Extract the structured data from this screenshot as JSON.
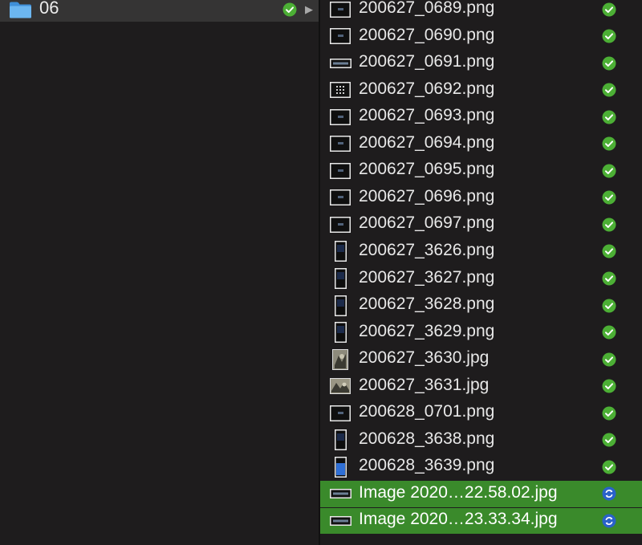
{
  "left": {
    "folder": {
      "name": "06",
      "icon": "folder-icon",
      "status": "synced",
      "disclosure": "▶"
    }
  },
  "files": [
    {
      "name": "200627_0689.png",
      "thumb": "landscape",
      "status": "synced"
    },
    {
      "name": "200627_0690.png",
      "thumb": "landscape",
      "status": "synced"
    },
    {
      "name": "200627_0691.png",
      "thumb": "wide",
      "status": "synced"
    },
    {
      "name": "200627_0692.png",
      "thumb": "square",
      "status": "synced"
    },
    {
      "name": "200627_0693.png",
      "thumb": "landscape",
      "status": "synced"
    },
    {
      "name": "200627_0694.png",
      "thumb": "landscape",
      "status": "synced"
    },
    {
      "name": "200627_0695.png",
      "thumb": "landscape",
      "status": "synced"
    },
    {
      "name": "200627_0696.png",
      "thumb": "landscape",
      "status": "synced"
    },
    {
      "name": "200627_0697.png",
      "thumb": "landscape",
      "status": "synced"
    },
    {
      "name": "200627_3626.png",
      "thumb": "portrait",
      "status": "synced"
    },
    {
      "name": "200627_3627.png",
      "thumb": "portrait",
      "status": "synced"
    },
    {
      "name": "200627_3628.png",
      "thumb": "portrait",
      "status": "synced"
    },
    {
      "name": "200627_3629.png",
      "thumb": "portrait",
      "status": "synced"
    },
    {
      "name": "200627_3630.jpg",
      "thumb": "photo-portrait",
      "status": "synced"
    },
    {
      "name": "200627_3631.jpg",
      "thumb": "photo-landscape",
      "status": "synced"
    },
    {
      "name": "200628_0701.png",
      "thumb": "landscape",
      "status": "synced"
    },
    {
      "name": "200628_3638.png",
      "thumb": "portrait",
      "status": "synced"
    },
    {
      "name": "200628_3639.png",
      "thumb": "portrait-blue",
      "status": "synced"
    },
    {
      "name": "Image 2020…22.58.02.jpg",
      "thumb": "wide",
      "status": "syncing",
      "selected": true
    },
    {
      "name": "Image 2020…23.33.34.jpg",
      "thumb": "wide",
      "status": "syncing",
      "selected": true
    }
  ],
  "colors": {
    "background": "#1e1c1d",
    "selected_row": "#3a8a2b",
    "folder_row": "#353434",
    "synced_badge": "#4caf35",
    "syncing_badge": "#2a62c9",
    "folder_blue": "#5aa6e6"
  }
}
